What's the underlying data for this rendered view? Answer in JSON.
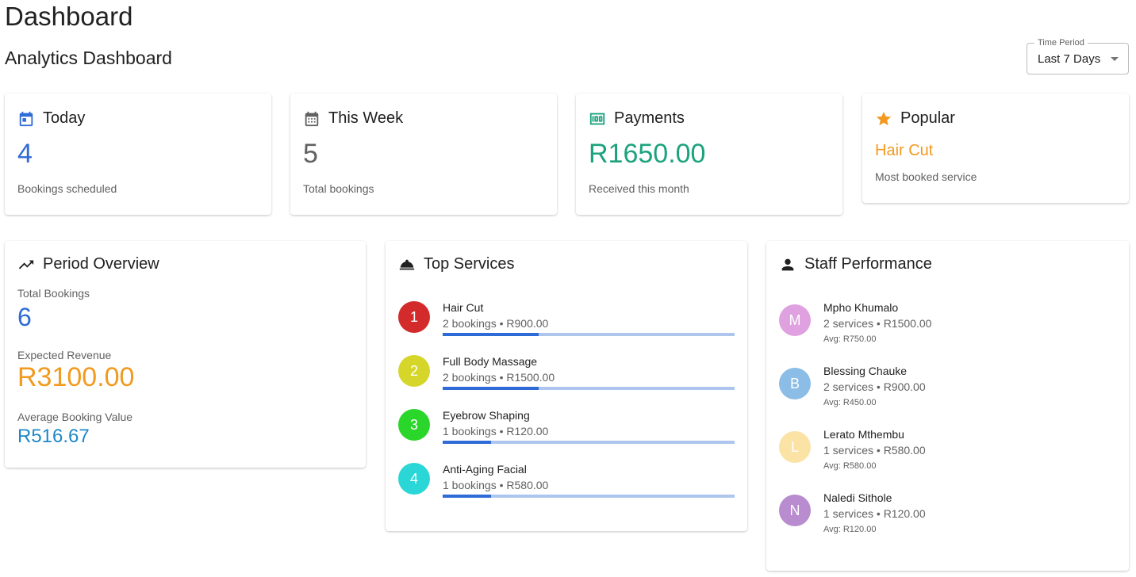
{
  "header": {
    "title": "Dashboard",
    "subtitle": "Analytics Dashboard",
    "period_label": "Time Period",
    "period_value": "Last 7 Days"
  },
  "stats": {
    "today": {
      "title": "Today",
      "value": "4",
      "sub": "Bookings scheduled",
      "icon": "calendar-today-icon",
      "color": "#2f6bd6"
    },
    "week": {
      "title": "This Week",
      "value": "5",
      "sub": "Total bookings",
      "icon": "calendar-month-icon",
      "color": "#616161"
    },
    "payments": {
      "title": "Payments",
      "value": "R1650.00",
      "sub": "Received this month",
      "icon": "money-icon",
      "color": "#1ca37e"
    },
    "popular": {
      "title": "Popular",
      "value": "Hair Cut",
      "sub": "Most booked service",
      "icon": "star-icon",
      "color": "#f29a1f"
    }
  },
  "overview": {
    "title": "Period Overview",
    "icon": "trending-up-icon",
    "total_label": "Total Bookings",
    "total_value": "6",
    "revenue_label": "Expected Revenue",
    "revenue_value": "R3100.00",
    "avg_label": "Average Booking Value",
    "avg_value": "R516.67",
    "colors": {
      "total": "#2f6bd6",
      "revenue": "#f29a1f",
      "avg": "#1e88c8"
    }
  },
  "services": {
    "title": "Top Services",
    "icon": "room-service-icon",
    "items": [
      {
        "rank": "1",
        "name": "Hair Cut",
        "meta": "2 bookings • R900.00",
        "share": 0.33,
        "color": "#d32b2b"
      },
      {
        "rank": "2",
        "name": "Full Body Massage",
        "meta": "2 bookings • R1500.00",
        "share": 0.33,
        "color": "#d6d62a"
      },
      {
        "rank": "3",
        "name": "Eyebrow Shaping",
        "meta": "1 bookings • R120.00",
        "share": 0.165,
        "color": "#2ad62a"
      },
      {
        "rank": "4",
        "name": "Anti-Aging Facial",
        "meta": "1 bookings • R580.00",
        "share": 0.165,
        "color": "#2ad6d6"
      }
    ]
  },
  "staff": {
    "title": "Staff Performance",
    "icon": "person-icon",
    "items": [
      {
        "initial": "M",
        "name": "Mpho Khumalo",
        "meta": "2 services • R1500.00",
        "avg": "Avg: R750.00",
        "color": "#e0a1e0"
      },
      {
        "initial": "B",
        "name": "Blessing Chauke",
        "meta": "2 services • R900.00",
        "avg": "Avg: R450.00",
        "color": "#8cbde6"
      },
      {
        "initial": "L",
        "name": "Lerato Mthembu",
        "meta": "1 services • R580.00",
        "avg": "Avg: R580.00",
        "color": "#fbe3a6"
      },
      {
        "initial": "N",
        "name": "Naledi Sithole",
        "meta": "1 services • R120.00",
        "avg": "Avg: R120.00",
        "color": "#b98bcf"
      }
    ]
  }
}
